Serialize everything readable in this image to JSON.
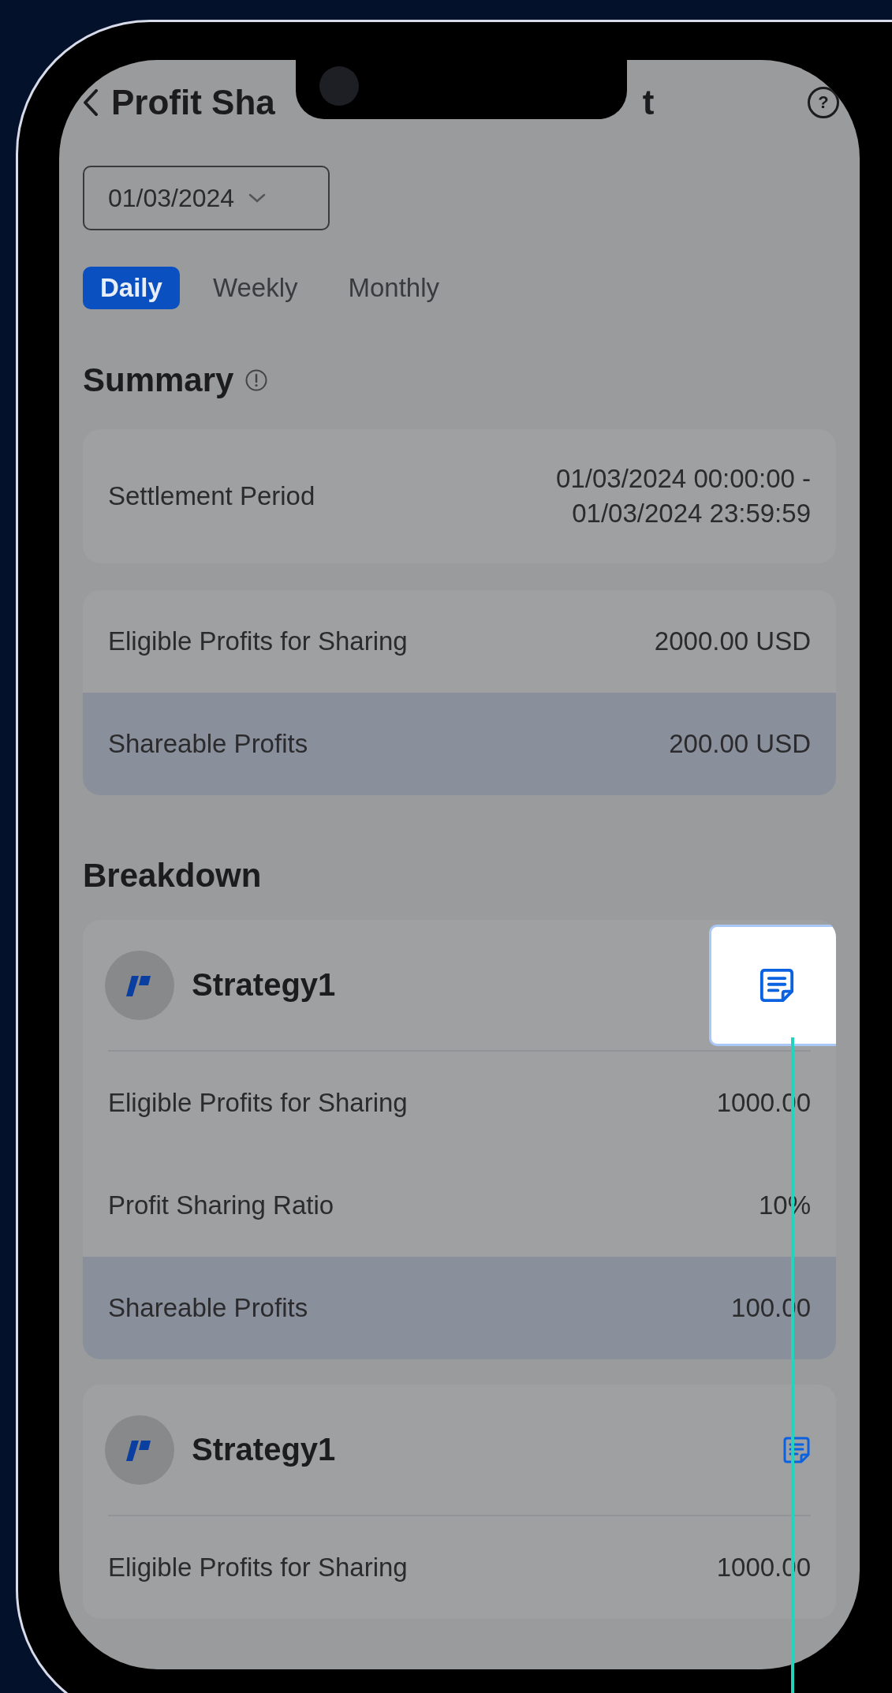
{
  "header": {
    "title_start": "Profit Sha",
    "title_end": "t",
    "help": "?"
  },
  "date_picker": {
    "value": "01/03/2024"
  },
  "tabs": [
    {
      "label": "Daily",
      "selected": true
    },
    {
      "label": "Weekly",
      "selected": false
    },
    {
      "label": "Monthly",
      "selected": false
    }
  ],
  "summary": {
    "title": "Summary",
    "period": {
      "label": "Settlement Period",
      "lines": [
        "01/03/2024 00:00:00 -",
        "01/03/2024 23:59:59"
      ]
    },
    "rows": [
      {
        "label": "Eligible Profits for Sharing",
        "value": "2000.00 USD",
        "highlighted": false
      },
      {
        "label": "Shareable Profits",
        "value": "200.00 USD",
        "highlighted": true
      }
    ]
  },
  "breakdown": {
    "title": "Breakdown",
    "strategies": [
      {
        "name": "Strategy1",
        "spotlight": true,
        "rows": [
          {
            "label": "Eligible Profits for Sharing",
            "value": "1000.00",
            "highlighted": false
          },
          {
            "label": "Profit Sharing Ratio",
            "value": "10%",
            "highlighted": false
          },
          {
            "label": "Shareable Profits",
            "value": "100.00",
            "highlighted": true
          }
        ]
      },
      {
        "name": "Strategy1",
        "spotlight": false,
        "rows": [
          {
            "label": "Eligible Profits for Sharing",
            "value": "1000.00",
            "highlighted": false
          }
        ]
      }
    ]
  }
}
